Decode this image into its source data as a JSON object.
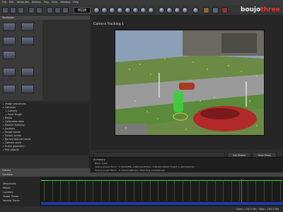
{
  "menu": [
    "File",
    "Edit",
    "Attributes",
    "Actions",
    "Play",
    "View",
    "Window",
    "Help"
  ],
  "toolbar": {
    "frame": "0118",
    "logo_main": "boujo",
    "logo_accent": "three"
  },
  "panels": {
    "toolbox": "Toolboxes",
    "history": "History",
    "timeline": "Timeline",
    "summary": "Summary"
  },
  "tree_items": [
    "Image sequences",
    "Cameras",
    "Camera",
    "Focal length",
    "Masks",
    "Calibration data",
    "Feature tracking",
    "Locators",
    "Target tracks",
    "Survey points",
    "Named feature tracks",
    "Camera solve",
    "Scene geometry",
    "Test objects"
  ],
  "view": {
    "title": "Camera Tracking 1",
    "get_status": "Get Status",
    "stop": "Stop Proxy"
  },
  "summary_lines": [
    "Begin solve",
    "Saving project file to : C:\\DOCUME~1\\Rbovy\\LOCALS~1\\Temp\\Untitled Project_C_autosave.bjx",
    "Saving project file to : D:\\Tracking\\Boujou 3\\tracking examples.bjx"
  ],
  "timeline_tracks": [
    "Sequences",
    "Masks",
    "Locators",
    "Target Tracks",
    "Named Tracks"
  ],
  "status": {
    "used": "Used : 120.7 Mb",
    "total": "Total : 163.5 Mb"
  },
  "colors": {
    "accent_green": "#3cdc3c",
    "playhead": "#3f64ff",
    "logo_accent": "#e33333"
  }
}
